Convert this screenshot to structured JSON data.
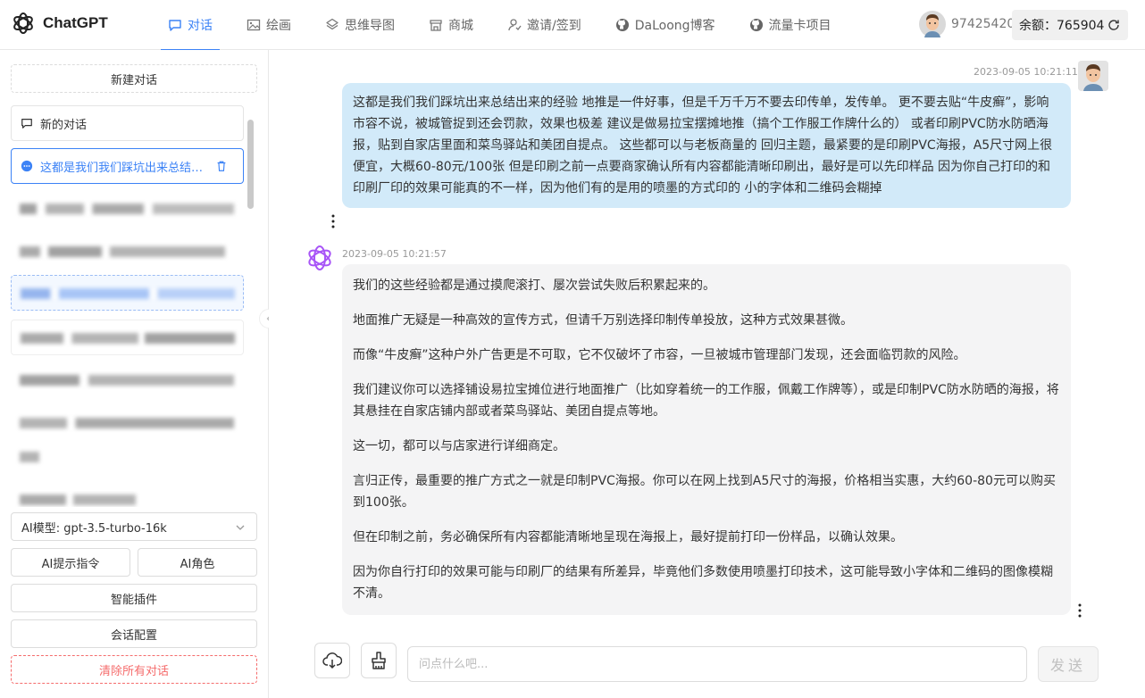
{
  "app": {
    "title": "ChatGPT"
  },
  "nav": [
    {
      "label": "对话",
      "icon": "chat-icon",
      "active": true
    },
    {
      "label": "绘画",
      "icon": "image-icon",
      "active": false
    },
    {
      "label": "思维导图",
      "icon": "mindmap-icon",
      "active": false
    },
    {
      "label": "商城",
      "icon": "store-icon",
      "active": false
    },
    {
      "label": "邀请/签到",
      "icon": "invite-icon",
      "active": false
    },
    {
      "label": "DaLoong博客",
      "icon": "github-icon",
      "active": false
    },
    {
      "label": "流量卡项目",
      "icon": "github-icon",
      "active": false
    }
  ],
  "user": {
    "id": "97425420",
    "balance_label": "余额：765904"
  },
  "sidebar": {
    "new_chat": "新建对话",
    "conversations": [
      {
        "label": "新的对话",
        "active": false
      },
      {
        "label": "这都是我们我们踩坑出来总结出来的经验 地推是一件好事",
        "active": true
      }
    ],
    "model_label": "AI模型: gpt-3.5-turbo-16k",
    "prompt_button": "AI提示指令",
    "role_button": "AI角色",
    "plugins_button": "智能插件",
    "session_config_button": "会话配置",
    "clear_all_button": "清除所有对话"
  },
  "messages": {
    "user": {
      "timestamp": "2023-09-05 10:21:11",
      "text": "这都是我们我们踩坑出来总结出来的经验 地推是一件好事，但是千万千万不要去印传单，发传单。 更不要去贴“牛皮癣”，影响市容不说，被城管捉到还会罚款，效果也极差 建议是做易拉宝摆摊地推（搞个工作服工作牌什么的） 或者印刷PVC防水防晒海报，贴到自家店里面和菜鸟驿站和美团自提点。 这些都可以与老板商量的 回归主题，最紧要的是印刷PVC海报，A5尺寸网上很便宜，大概60-80元/100张 但是印刷之前一点要商家确认所有内容都能清晰印刷出，最好是可以先印样品 因为你自己打印的和印刷厂印的效果可能真的不一样，因为他们有的是用的喷墨的方式印的 小的字体和二维码会糊掉"
    },
    "ai": {
      "timestamp": "2023-09-05 10:21:57",
      "paragraphs": [
        "我们的这些经验都是通过摸爬滚打、屡次尝试失败后积累起来的。",
        "地面推广无疑是一种高效的宣传方式，但请千万别选择印制传单投放，这种方式效果甚微。",
        "而像“牛皮癣”这种户外广告更是不可取，它不仅破坏了市容，一旦被城市管理部门发现，还会面临罚款的风险。",
        "我们建议你可以选择铺设易拉宝摊位进行地面推广（比如穿着统一的工作服，佩戴工作牌等），或是印制PVC防水防晒的海报，将其悬挂在自家店铺内部或者菜鸟驿站、美团自提点等地。",
        "这一切，都可以与店家进行详细商定。",
        "言归正传，最重要的推广方式之一就是印制PVC海报。你可以在网上找到A5尺寸的海报，价格相当实惠，大约60-80元可以购买到100张。",
        "但在印制之前，务必确保所有内容都能清晰地呈现在海报上，最好提前打印一份样品，以确认效果。",
        "因为你自行打印的效果可能与印刷厂的结果有所差异，毕竟他们多数使用喷墨打印技术，这可能导致小字体和二维码的图像模糊不清。"
      ]
    }
  },
  "composer": {
    "placeholder": "问点什么吧...",
    "send_label": "发送"
  },
  "colors": {
    "accent": "#3b82f6",
    "user_bubble": "#d2eaf9",
    "ai_bubble": "#f4f4f5",
    "danger": "#f56c6c"
  }
}
